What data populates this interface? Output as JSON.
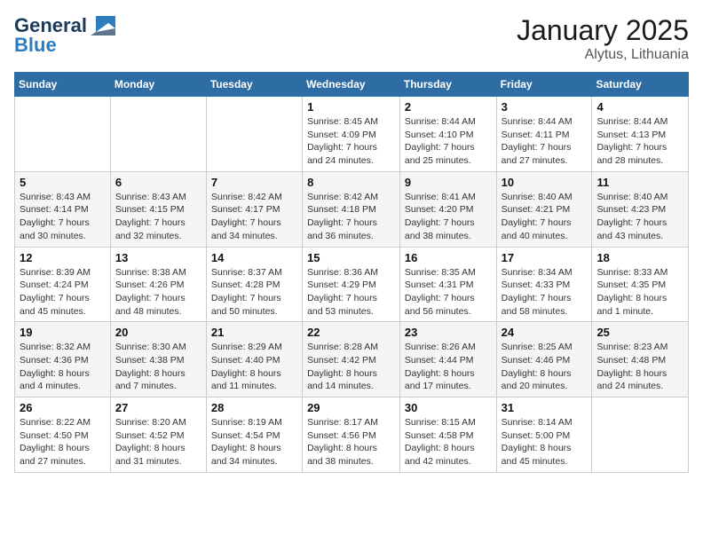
{
  "logo": {
    "line1": "General",
    "line2": "Blue"
  },
  "title": "January 2025",
  "subtitle": "Alytus, Lithuania",
  "headers": [
    "Sunday",
    "Monday",
    "Tuesday",
    "Wednesday",
    "Thursday",
    "Friday",
    "Saturday"
  ],
  "weeks": [
    [
      {
        "day": "",
        "info": ""
      },
      {
        "day": "",
        "info": ""
      },
      {
        "day": "",
        "info": ""
      },
      {
        "day": "1",
        "info": "Sunrise: 8:45 AM\nSunset: 4:09 PM\nDaylight: 7 hours\nand 24 minutes."
      },
      {
        "day": "2",
        "info": "Sunrise: 8:44 AM\nSunset: 4:10 PM\nDaylight: 7 hours\nand 25 minutes."
      },
      {
        "day": "3",
        "info": "Sunrise: 8:44 AM\nSunset: 4:11 PM\nDaylight: 7 hours\nand 27 minutes."
      },
      {
        "day": "4",
        "info": "Sunrise: 8:44 AM\nSunset: 4:13 PM\nDaylight: 7 hours\nand 28 minutes."
      }
    ],
    [
      {
        "day": "5",
        "info": "Sunrise: 8:43 AM\nSunset: 4:14 PM\nDaylight: 7 hours\nand 30 minutes."
      },
      {
        "day": "6",
        "info": "Sunrise: 8:43 AM\nSunset: 4:15 PM\nDaylight: 7 hours\nand 32 minutes."
      },
      {
        "day": "7",
        "info": "Sunrise: 8:42 AM\nSunset: 4:17 PM\nDaylight: 7 hours\nand 34 minutes."
      },
      {
        "day": "8",
        "info": "Sunrise: 8:42 AM\nSunset: 4:18 PM\nDaylight: 7 hours\nand 36 minutes."
      },
      {
        "day": "9",
        "info": "Sunrise: 8:41 AM\nSunset: 4:20 PM\nDaylight: 7 hours\nand 38 minutes."
      },
      {
        "day": "10",
        "info": "Sunrise: 8:40 AM\nSunset: 4:21 PM\nDaylight: 7 hours\nand 40 minutes."
      },
      {
        "day": "11",
        "info": "Sunrise: 8:40 AM\nSunset: 4:23 PM\nDaylight: 7 hours\nand 43 minutes."
      }
    ],
    [
      {
        "day": "12",
        "info": "Sunrise: 8:39 AM\nSunset: 4:24 PM\nDaylight: 7 hours\nand 45 minutes."
      },
      {
        "day": "13",
        "info": "Sunrise: 8:38 AM\nSunset: 4:26 PM\nDaylight: 7 hours\nand 48 minutes."
      },
      {
        "day": "14",
        "info": "Sunrise: 8:37 AM\nSunset: 4:28 PM\nDaylight: 7 hours\nand 50 minutes."
      },
      {
        "day": "15",
        "info": "Sunrise: 8:36 AM\nSunset: 4:29 PM\nDaylight: 7 hours\nand 53 minutes."
      },
      {
        "day": "16",
        "info": "Sunrise: 8:35 AM\nSunset: 4:31 PM\nDaylight: 7 hours\nand 56 minutes."
      },
      {
        "day": "17",
        "info": "Sunrise: 8:34 AM\nSunset: 4:33 PM\nDaylight: 7 hours\nand 58 minutes."
      },
      {
        "day": "18",
        "info": "Sunrise: 8:33 AM\nSunset: 4:35 PM\nDaylight: 8 hours\nand 1 minute."
      }
    ],
    [
      {
        "day": "19",
        "info": "Sunrise: 8:32 AM\nSunset: 4:36 PM\nDaylight: 8 hours\nand 4 minutes."
      },
      {
        "day": "20",
        "info": "Sunrise: 8:30 AM\nSunset: 4:38 PM\nDaylight: 8 hours\nand 7 minutes."
      },
      {
        "day": "21",
        "info": "Sunrise: 8:29 AM\nSunset: 4:40 PM\nDaylight: 8 hours\nand 11 minutes."
      },
      {
        "day": "22",
        "info": "Sunrise: 8:28 AM\nSunset: 4:42 PM\nDaylight: 8 hours\nand 14 minutes."
      },
      {
        "day": "23",
        "info": "Sunrise: 8:26 AM\nSunset: 4:44 PM\nDaylight: 8 hours\nand 17 minutes."
      },
      {
        "day": "24",
        "info": "Sunrise: 8:25 AM\nSunset: 4:46 PM\nDaylight: 8 hours\nand 20 minutes."
      },
      {
        "day": "25",
        "info": "Sunrise: 8:23 AM\nSunset: 4:48 PM\nDaylight: 8 hours\nand 24 minutes."
      }
    ],
    [
      {
        "day": "26",
        "info": "Sunrise: 8:22 AM\nSunset: 4:50 PM\nDaylight: 8 hours\nand 27 minutes."
      },
      {
        "day": "27",
        "info": "Sunrise: 8:20 AM\nSunset: 4:52 PM\nDaylight: 8 hours\nand 31 minutes."
      },
      {
        "day": "28",
        "info": "Sunrise: 8:19 AM\nSunset: 4:54 PM\nDaylight: 8 hours\nand 34 minutes."
      },
      {
        "day": "29",
        "info": "Sunrise: 8:17 AM\nSunset: 4:56 PM\nDaylight: 8 hours\nand 38 minutes."
      },
      {
        "day": "30",
        "info": "Sunrise: 8:15 AM\nSunset: 4:58 PM\nDaylight: 8 hours\nand 42 minutes."
      },
      {
        "day": "31",
        "info": "Sunrise: 8:14 AM\nSunset: 5:00 PM\nDaylight: 8 hours\nand 45 minutes."
      },
      {
        "day": "",
        "info": ""
      }
    ]
  ]
}
